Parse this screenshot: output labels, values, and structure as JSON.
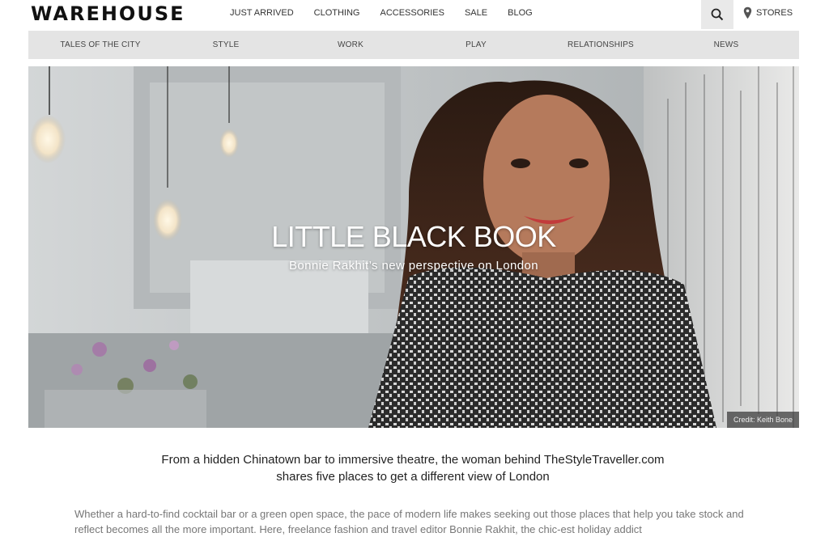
{
  "header": {
    "logo": "WAREHOUSE",
    "nav": [
      "JUST ARRIVED",
      "CLOTHING",
      "ACCESSORIES",
      "SALE",
      "BLOG"
    ],
    "stores_label": "STORES",
    "search_icon": "search-icon",
    "pin_icon": "map-pin-icon"
  },
  "category_bar": {
    "items": [
      "TALES OF THE CITY",
      "STYLE",
      "WORK",
      "PLAY",
      "RELATIONSHIPS",
      "NEWS"
    ]
  },
  "hero": {
    "title": "LITTLE BLACK BOOK",
    "subtitle": "Bonnie Rakhit’s new perspective on London",
    "credit": "Credit: Keith Bone"
  },
  "intro": {
    "line1": "From a hidden Chinatown bar to immersive theatre, the woman behind TheStyleTraveller.com",
    "line2": "shares five places to get a different view of London"
  },
  "body": {
    "paragraph": "Whether a hard-to-find cocktail bar or a green open space, the pace of modern life makes seeking out those places that help you take stock and reflect becomes all the more important. Here, freelance fashion and travel editor Bonnie Rakhit, the chic-est holiday addict"
  },
  "colors": {
    "category_bar_bg": "#e4e4e4",
    "search_bg": "#e9e9e9",
    "body_text": "#777777"
  }
}
